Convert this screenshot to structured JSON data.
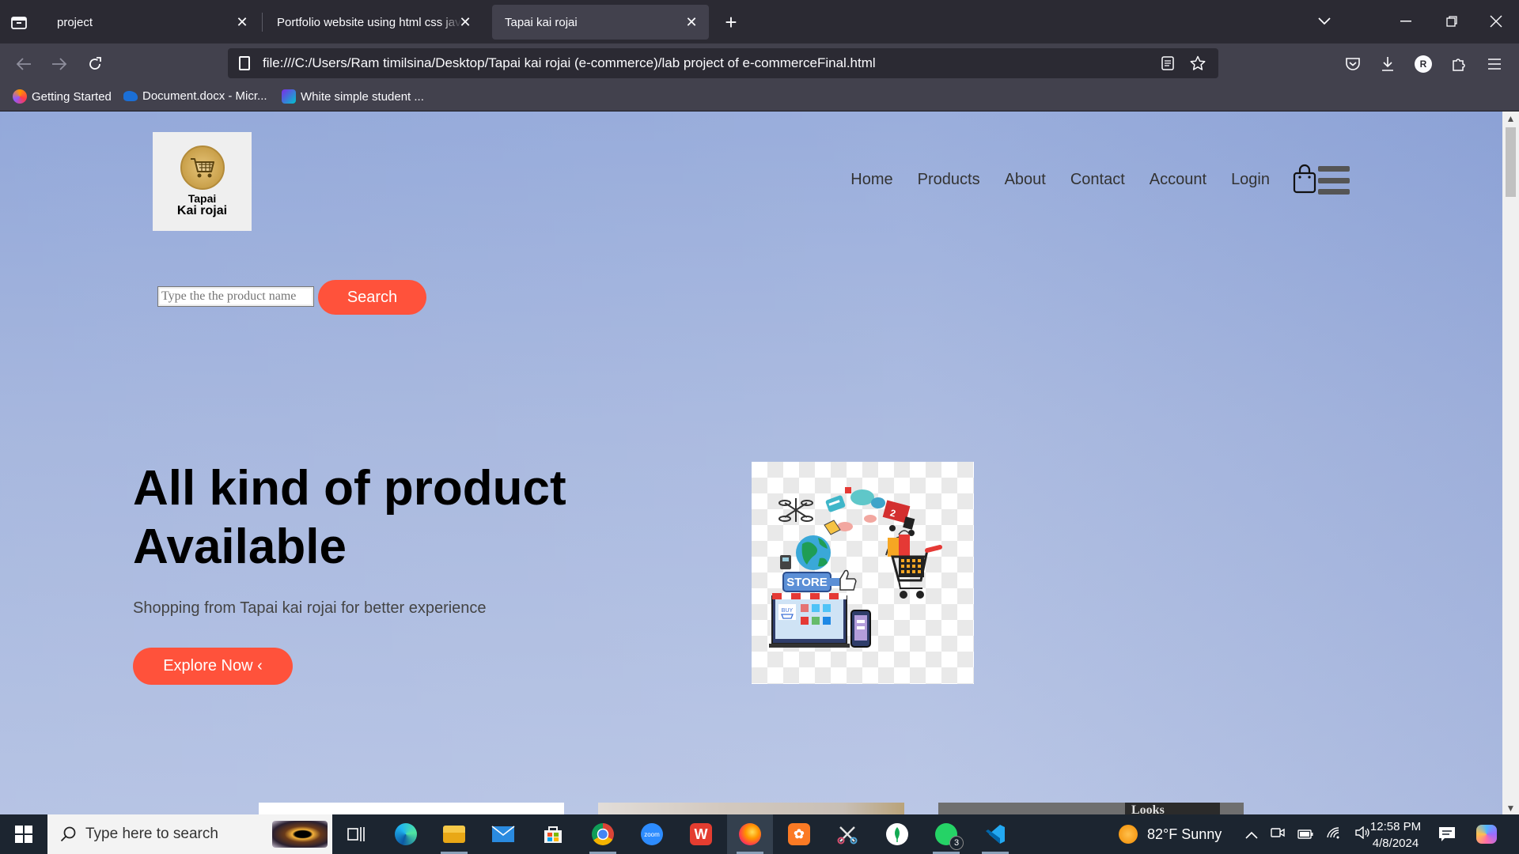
{
  "browser": {
    "tabs": [
      {
        "title": "project"
      },
      {
        "title": "Portfolio website using html css javascript"
      },
      {
        "title": "Tapai kai rojai",
        "active": true
      }
    ],
    "url": "file:///C:/Users/Ram timilsina/Desktop/Tapai kai rojai (e-commerce)/lab project of e-commerceFinal.html",
    "bookmarks": [
      {
        "label": "Getting Started"
      },
      {
        "label": "Document.docx - Micr..."
      },
      {
        "label": "White simple student ..."
      }
    ],
    "profile_initial": "R"
  },
  "site": {
    "logo": {
      "line1": "Tapai",
      "line2": "Kai rojai"
    },
    "nav": [
      "Home",
      "Products",
      "About",
      "Contact",
      "Account",
      "Login"
    ],
    "search": {
      "placeholder": "Type the the product name",
      "button": "Search"
    },
    "hero": {
      "title_line1": "All kind of product",
      "title_line2": "Available",
      "subtitle": "Shopping from Tapai kai rojai for better experience",
      "cta": "Explore Now ‹",
      "image_labels": {
        "store": "STORE",
        "buy": "BUY"
      }
    },
    "product_cards": [
      {
        "banner": ""
      },
      {
        "banner": ""
      },
      {
        "banner": "Looks"
      }
    ]
  },
  "taskbar": {
    "search_placeholder": "Type here to search",
    "weather": "82°F  Sunny",
    "time": "12:58 PM",
    "date": "4/8/2024",
    "whatsapp_badge": "3"
  },
  "colors": {
    "accent": "#ff523b",
    "page_bg": "#a3b4dd",
    "chrome_dark": "#2b2a33",
    "chrome_mid": "#42414d"
  }
}
